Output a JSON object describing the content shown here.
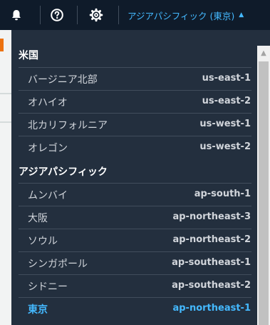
{
  "topbar": {
    "icons": [
      "bell-icon",
      "help-icon",
      "gear-icon"
    ],
    "region_label": "アジアパシフィック (東京)",
    "caret": "▲"
  },
  "colors": {
    "topbar_bg": "#0f1b2a",
    "panel_bg": "#232f3e",
    "accent": "#44b9ff",
    "text": "#d1d5db",
    "divider": "#414d5c"
  },
  "region_menu": {
    "groups": [
      {
        "title": "米国",
        "items": [
          {
            "name": "バージニア北部",
            "code": "us-east-1"
          },
          {
            "name": "オハイオ",
            "code": "us-east-2"
          },
          {
            "name": "北カリフォルニア",
            "code": "us-west-1"
          },
          {
            "name": "オレゴン",
            "code": "us-west-2"
          }
        ]
      },
      {
        "title": "アジアパシフィック",
        "items": [
          {
            "name": "ムンバイ",
            "code": "ap-south-1"
          },
          {
            "name": "大阪",
            "code": "ap-northeast-3"
          },
          {
            "name": "ソウル",
            "code": "ap-northeast-2"
          },
          {
            "name": "シンガポール",
            "code": "ap-southeast-1"
          },
          {
            "name": "シドニー",
            "code": "ap-southeast-2"
          },
          {
            "name": "東京",
            "code": "ap-northeast-1",
            "selected": true
          }
        ]
      }
    ]
  }
}
